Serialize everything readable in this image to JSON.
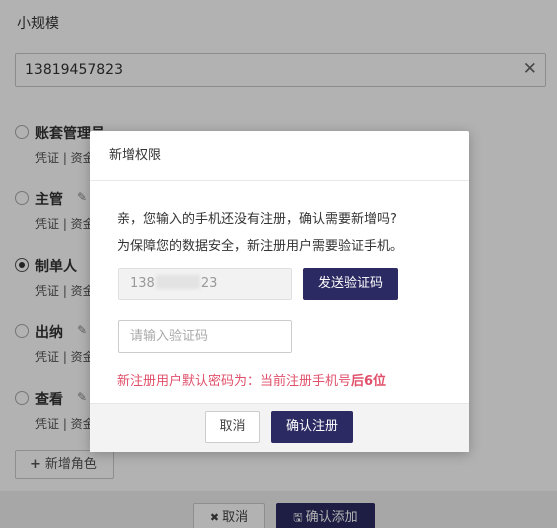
{
  "page": {
    "title": "小规模",
    "phone_value": "13819457823",
    "roles": [
      {
        "name": "账套管理员",
        "perms": "凭证 | 资金",
        "checked": false,
        "editable": false
      },
      {
        "name": "主管",
        "perms": "凭证 | 资金",
        "checked": false,
        "editable": true
      },
      {
        "name": "制单人",
        "perms": "凭证 | 资金",
        "checked": true,
        "editable": false
      },
      {
        "name": "出纳",
        "perms": "凭证 | 资金",
        "checked": false,
        "editable": true
      },
      {
        "name": "查看",
        "perms": "凭证 | 资金",
        "checked": false,
        "editable": true
      }
    ],
    "add_role_label": "新增角色",
    "cancel_label": "取消",
    "confirm_label": "确认添加"
  },
  "dialog": {
    "title": "新增权限",
    "line1": "亲，您输入的手机还没有注册，确认需要新增吗?",
    "line2": "为保障您的数据安全，新注册用户需要验证手机。",
    "phone_prefix": "138",
    "phone_suffix": "23",
    "send_code_label": "发送验证码",
    "code_placeholder": "请输入验证码",
    "notice_prefix": "新注册用户默认密码为：当前注册手机号",
    "notice_bold": "后6位",
    "cancel_label": "取消",
    "confirm_label": "确认注册"
  },
  "colors": {
    "primary": "#2b2a62",
    "notice": "#e0506a",
    "overlay": "rgba(0,0,0,0.3)"
  },
  "icons": [
    "clear-icon",
    "edit-icon",
    "plus-icon",
    "close-x-icon",
    "save-icon"
  ]
}
